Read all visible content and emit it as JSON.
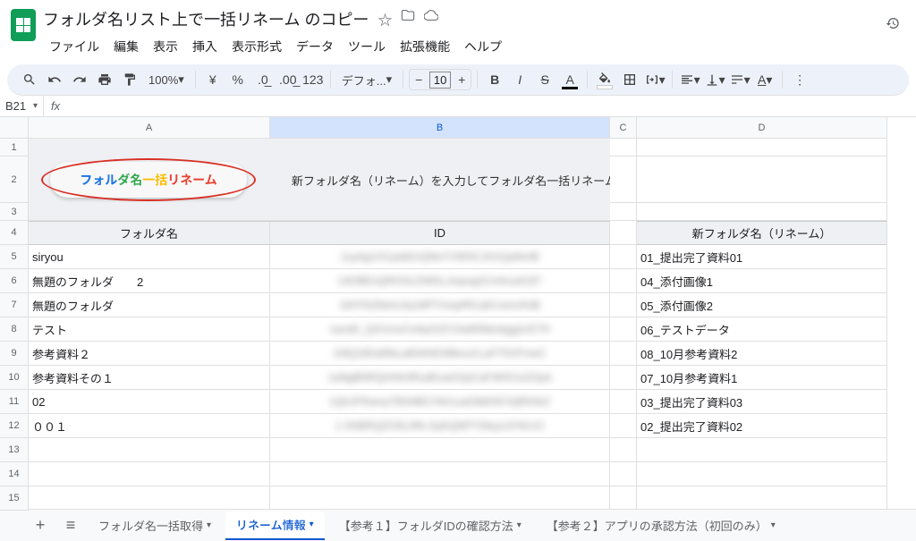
{
  "doc": {
    "title": "フォルダ名リスト上で一括リネーム のコピー"
  },
  "menu": {
    "file": "ファイル",
    "edit": "編集",
    "view": "表示",
    "insert": "挿入",
    "format": "表示形式",
    "data": "データ",
    "tools": "ツール",
    "extensions": "拡張機能",
    "help": "ヘルプ"
  },
  "toolbar": {
    "zoom": "100%",
    "currency": "¥",
    "percent": "%",
    "font": "デフォ...",
    "fontsize": "10",
    "bold": "B",
    "italic": "I",
    "strike": "S",
    "textA": "A",
    "n123": "123"
  },
  "namebox": "B21",
  "cols": {
    "A": "A",
    "B": "B",
    "C": "C",
    "D": "D"
  },
  "headers": {
    "folder": "フォルダ名",
    "id": "ID",
    "newname": "新フォルダ名（リネーム）"
  },
  "button": {
    "p1": "フォル",
    "p2": "ダ名",
    "p3": "一括",
    "p4": "リネーム"
  },
  "instruction": "新フォルダ名（リネーム）を入力してフォルダ名一括リネームボタンを押してください。",
  "rows": [
    {
      "a": "siryou",
      "d": "01_提出完了資料01"
    },
    {
      "a": "無題のフォルダ　　2",
      "d": "04_添付画像1"
    },
    {
      "a": "無題のフォルダ",
      "d": "05_添付画像2"
    },
    {
      "a": "テスト",
      "d": "06_テストデータ"
    },
    {
      "a": "参考資料２",
      "d": "08_10月参考資料2"
    },
    {
      "a": "参考資料その１",
      "d": "07_10月参考資料1"
    },
    {
      "a": "02",
      "d": "03_提出完了資料03"
    },
    {
      "a": "００１",
      "d": "02_提出完了資料02"
    }
  ],
  "blurred": [
    "1xyAg1XCpdd2vQNeYVWSCJH1QaNmB",
    "14OBExQROGLEMSLJmpng2Cmhca4197",
    "1kHYbZkbnLKp18PYmxpRlCakCosncKd8",
    "1and5_Q2UmuCmbyGZCOaW0kbnkgg2cE7H",
    "10lQ18OaRbLaB3AhEWlknuCLaFT5VFmeC",
    "1aNgBNRQHHk3RudEowO2pCaF4KRJu2OpA",
    "1QhJFRamyTBSNB1Ykh1uaO8dO67i2jRh0e2",
    "1-ShBRQZOSLIRk-SyKQNPYSleyz1FACrO"
  ],
  "tabs": {
    "t1": "フォルダ名一括取得",
    "t2": "リネーム情報",
    "t3": "【参考１】フォルダIDの確認方法",
    "t4": "【参考２】アプリの承認方法（初回のみ）"
  }
}
